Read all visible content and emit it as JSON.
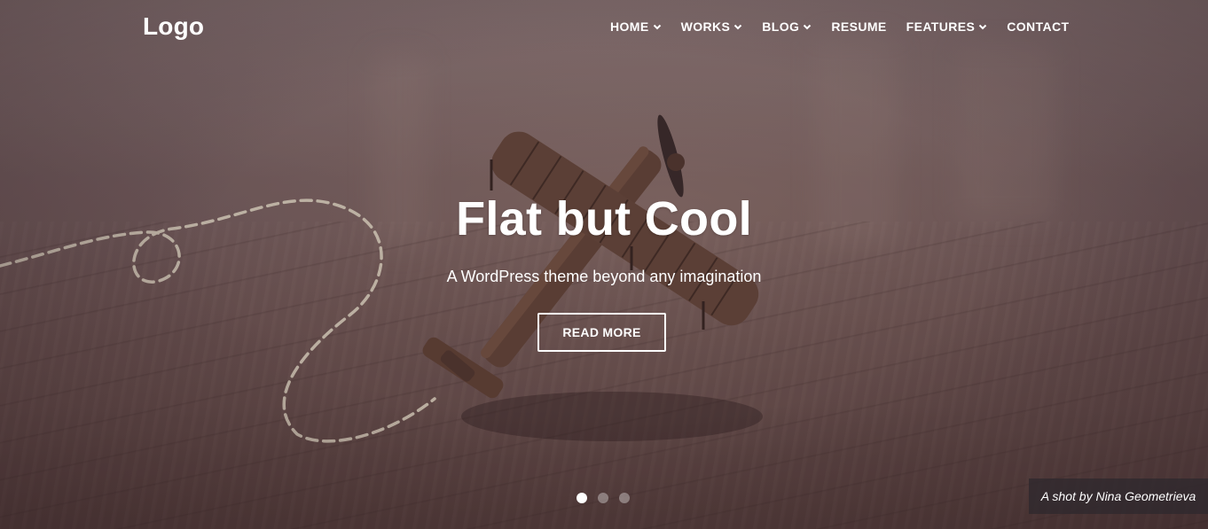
{
  "header": {
    "logo": "Logo",
    "nav": [
      {
        "label": "HOME",
        "has_dropdown": true
      },
      {
        "label": "WORKS",
        "has_dropdown": true
      },
      {
        "label": "BLOG",
        "has_dropdown": true
      },
      {
        "label": "RESUME",
        "has_dropdown": false
      },
      {
        "label": "FEATURES",
        "has_dropdown": true
      },
      {
        "label": "CONTACT",
        "has_dropdown": false
      }
    ]
  },
  "hero": {
    "title": "Flat but Cool",
    "subtitle": "A WordPress theme beyond any imagination",
    "cta_label": "READ MORE",
    "slides_total": 3,
    "active_slide": 1
  },
  "credit": "A shot by Nina Geometrieva",
  "colors": {
    "text": "#ffffff",
    "overlay_tint": "#6e5a54",
    "credit_bg": "#2d282d"
  },
  "icons": {
    "dropdown": "chevron-down-icon"
  }
}
